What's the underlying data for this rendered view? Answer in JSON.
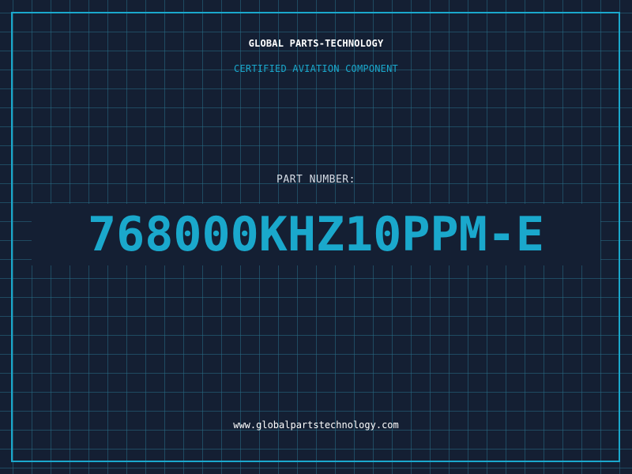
{
  "header": {
    "company": "GLOBAL PARTS-TECHNOLOGY",
    "certification": "CERTIFIED AVIATION COMPONENT"
  },
  "part": {
    "label": "PART NUMBER:",
    "number": "768000KHZ10PPM-E"
  },
  "footer": {
    "website": "www.globalpartstechnology.com"
  },
  "colors": {
    "background": "#141f33",
    "grid": "#286e87",
    "accent": "#1aa8cc",
    "text": "#ffffff"
  }
}
